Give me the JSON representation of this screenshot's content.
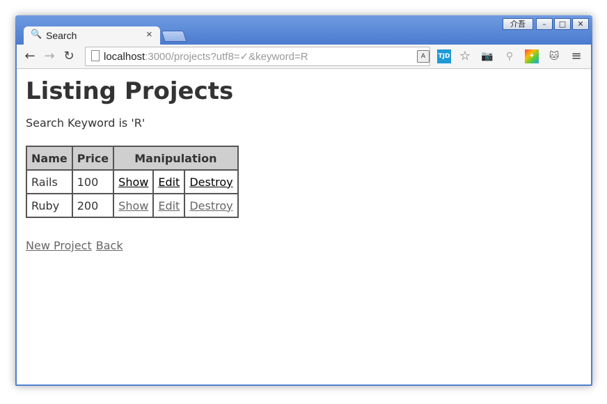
{
  "window": {
    "ime_label": "介吾",
    "controls": {
      "minimize": "–",
      "maximize": "□",
      "close": "✕"
    }
  },
  "tab": {
    "title": "Search",
    "icon": "search-icon",
    "close": "×"
  },
  "omnibox": {
    "host": "localhost",
    "rest": ":3000/projects?utf8=✓&keyword=R"
  },
  "extensions": {
    "tjd": "TJD",
    "star": "☆",
    "camera": "📷",
    "sitemap": "⚲",
    "menu": "≡"
  },
  "page": {
    "title": "Listing Projects",
    "keyword_line": "Search Keyword is 'R'",
    "table": {
      "headers": {
        "name": "Name",
        "price": "Price",
        "manipulation": "Manipulation"
      },
      "rows": [
        {
          "name": "Rails",
          "price": "100",
          "show": "Show",
          "edit": "Edit",
          "destroy": "Destroy"
        },
        {
          "name": "Ruby",
          "price": "200",
          "show": "Show",
          "edit": "Edit",
          "destroy": "Destroy"
        }
      ]
    },
    "links": {
      "new_project": "New Project",
      "back": "Back"
    }
  }
}
